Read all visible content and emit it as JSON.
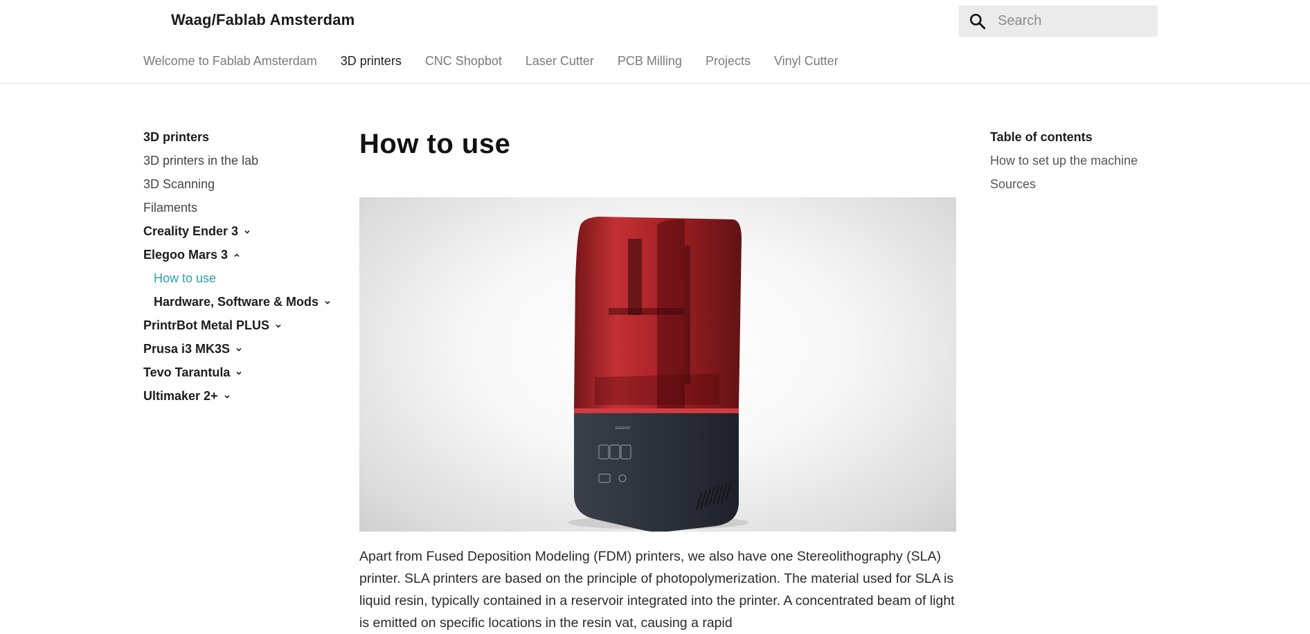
{
  "header": {
    "site_title": "Waag/Fablab Amsterdam",
    "search": {
      "placeholder": "Search",
      "value": ""
    },
    "nav": [
      {
        "label": "Welcome to Fablab Amsterdam",
        "active": false
      },
      {
        "label": "3D printers",
        "active": true
      },
      {
        "label": "CNC Shopbot",
        "active": false
      },
      {
        "label": "Laser Cutter",
        "active": false
      },
      {
        "label": "PCB Milling",
        "active": false
      },
      {
        "label": "Projects",
        "active": false
      },
      {
        "label": "Vinyl Cutter",
        "active": false
      }
    ]
  },
  "sidebar": {
    "section_title": "3D printers",
    "items": [
      {
        "label": "3D printers in the lab"
      },
      {
        "label": "3D Scanning"
      },
      {
        "label": "Filaments"
      },
      {
        "label": "Creality Ender 3",
        "expander": "collapsed"
      },
      {
        "label": "Elegoo Mars 3",
        "expander": "expanded"
      },
      {
        "label": "How to use",
        "current": true
      },
      {
        "label": "Hardware, Software & Mods",
        "expander": "collapsed"
      },
      {
        "label": "PrintrBot Metal PLUS",
        "expander": "collapsed"
      },
      {
        "label": "Prusa i3 MK3S",
        "expander": "collapsed"
      },
      {
        "label": "Tevo Tarantula",
        "expander": "collapsed"
      },
      {
        "label": "Ultimaker 2+",
        "expander": "collapsed"
      }
    ]
  },
  "main": {
    "title": "How to use",
    "hero_image": "elegoo-mars-3-resin-printer",
    "paragraph": "Apart from Fused Deposition Modeling (FDM) printers, we also have one Stereolithography (SLA) printer. SLA printers are based on the principle of photopolymerization. The material used for SLA is liquid resin, typically contained in a reservoir integrated into the printer. A concentrated beam of light is emitted on specific locations in the resin vat, causing a rapid"
  },
  "toc": {
    "title": "Table of contents",
    "items": [
      {
        "label": "How to set up the machine"
      },
      {
        "label": "Sources"
      }
    ]
  },
  "colors": {
    "accent": "#2aa1ad",
    "printer_lid": "#b3141a",
    "printer_base": "#2f3440"
  },
  "icons": {
    "search": "search-icon",
    "collapsed": "chevron-down-icon",
    "expanded": "chevron-up-icon"
  }
}
